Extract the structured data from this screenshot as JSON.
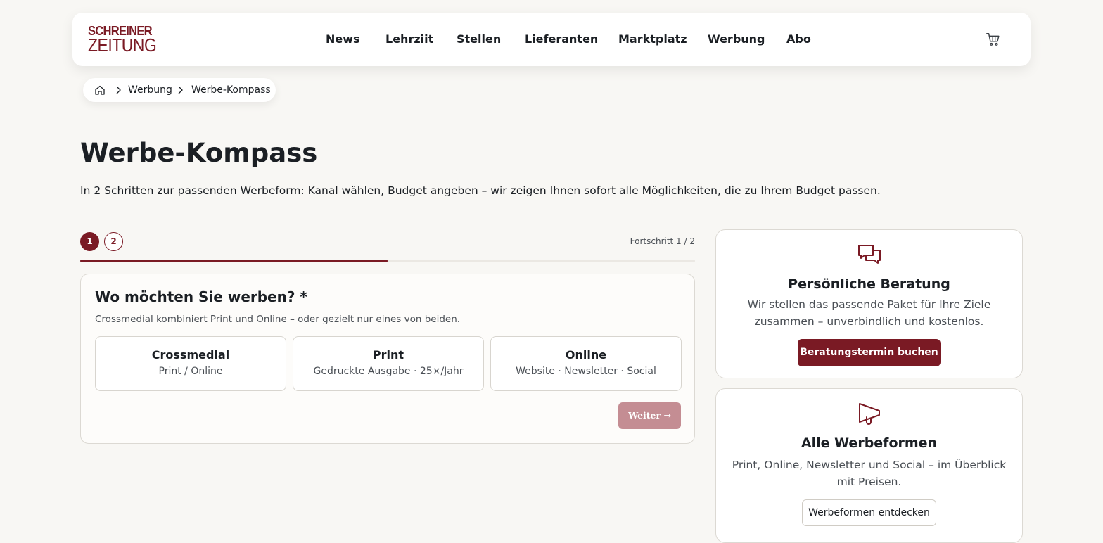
{
  "brand": {
    "line1": "SCHREINER",
    "line2": "ZEITUNG",
    "color": "#7a1a24"
  },
  "nav": {
    "items": [
      "News",
      "Lehrziit",
      "Stellen",
      "Lieferanten",
      "Marktplatz",
      "Werbung",
      "Abo"
    ],
    "cart_icon": "cart-icon"
  },
  "breadcrumb": {
    "home_icon": "home-icon",
    "items": [
      "Werbung",
      "Werbe-Kompass"
    ]
  },
  "page": {
    "title": "Werbe-Kompass",
    "intro": "In 2 Schritten zur passenden Werbeform: Kanal wählen, Budget angeben – wir zeigen Ihnen sofort alle Möglichkeiten, die zu Ihrem Budget passen."
  },
  "stepper": {
    "steps": [
      "1",
      "2"
    ],
    "current": 1,
    "progress_label": "Fortschritt 1 / 2",
    "progress_fraction": 0.5
  },
  "question": {
    "title": "Wo möchten Sie werben? *",
    "hint": "Crossmedial kombiniert Print und Online – oder gezielt nur eines von beiden.",
    "options": [
      {
        "title": "Crossmedial",
        "subtitle": "Print / Online"
      },
      {
        "title": "Print",
        "subtitle": "Gedruckte Ausgabe · 25×/Jahr"
      },
      {
        "title": "Online",
        "subtitle": "Website · Newsletter · Social"
      }
    ],
    "next_label": "Weiter →"
  },
  "sidebar": {
    "consult": {
      "icon": "chat-bubbles-icon",
      "title": "Persönliche Beratung",
      "text": "Wir stellen das passende Paket für Ihre Ziele zusammen – unverbindlich und kostenlos.",
      "button": "Beratungstermin buchen"
    },
    "formats": {
      "icon": "megaphone-icon",
      "title": "Alle Werbeformen",
      "text": "Print, Online, Newsletter und Social – im Überblick mit Preisen.",
      "button": "Werbeformen entdecken"
    }
  }
}
